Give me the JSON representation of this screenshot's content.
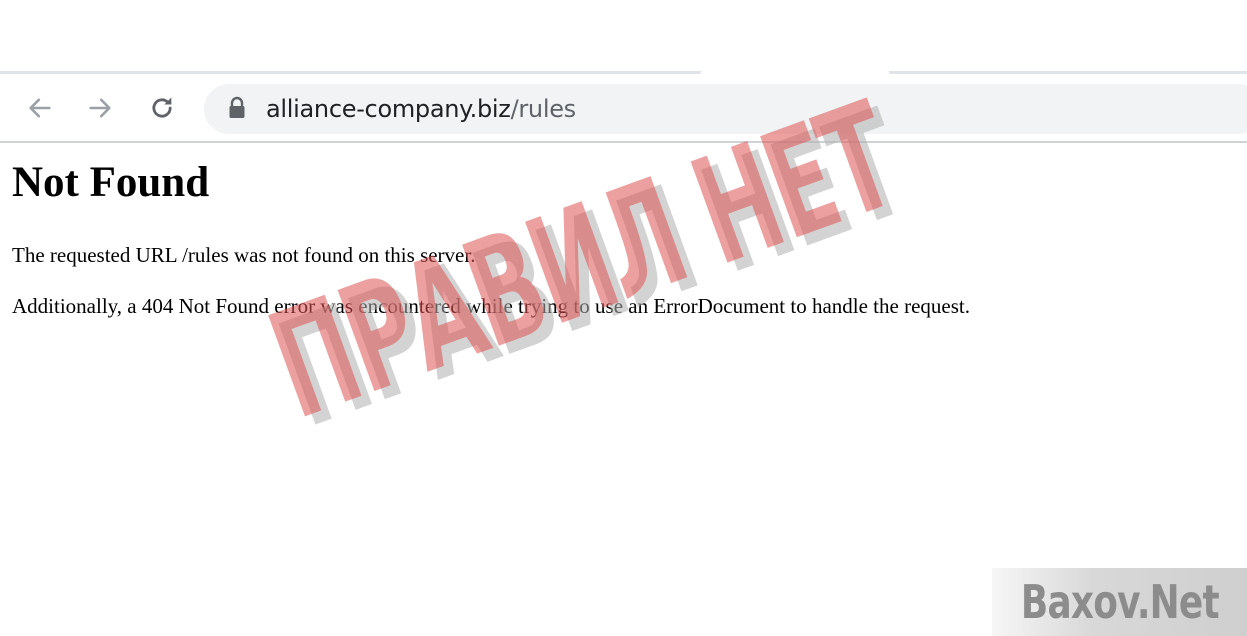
{
  "browser": {
    "url_domain": "alliance-company.biz",
    "url_path": "/rules",
    "icons": {
      "back": "back-arrow-icon",
      "forward": "forward-arrow-icon",
      "reload": "reload-icon",
      "lock": "lock-icon"
    }
  },
  "page": {
    "title": "Not Found",
    "message": "The requested URL /rules was not found on this server.",
    "additional": "Additionally, a 404 Not Found error was encountered while trying to use an ErrorDocument to handle the request."
  },
  "overlay": {
    "stamp_text": "ПРАВИЛ НЕТ",
    "stamp_color": "#de5252",
    "logo_text": "Baxov.Net"
  }
}
